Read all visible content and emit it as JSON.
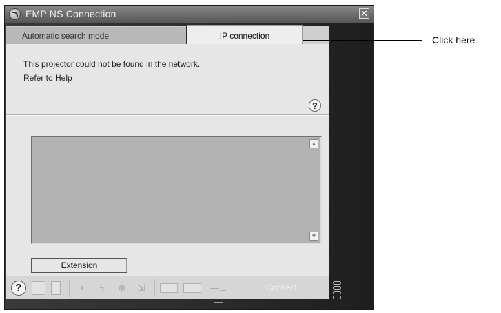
{
  "window": {
    "title": "EMP NS Connection",
    "close_glyph": "✕"
  },
  "tabs": {
    "auto": "Automatic search mode",
    "ip": "IP connection"
  },
  "content": {
    "message_line1": "This projector could not be found in the network.",
    "message_line2": "Refer to Help",
    "help_glyph": "?",
    "extension_label": "Extension"
  },
  "toolbar": {
    "help_glyph": "?",
    "connect_label": "Connect",
    "icons": [
      "help-icon",
      "monitor-icon",
      "document-icon",
      "pause-icon",
      "mute-icon",
      "zoom-icon",
      "rotate-icon",
      "video-icon",
      "keyboard-icon",
      "connect-line-icon"
    ]
  },
  "callout": {
    "text": "Click here"
  }
}
